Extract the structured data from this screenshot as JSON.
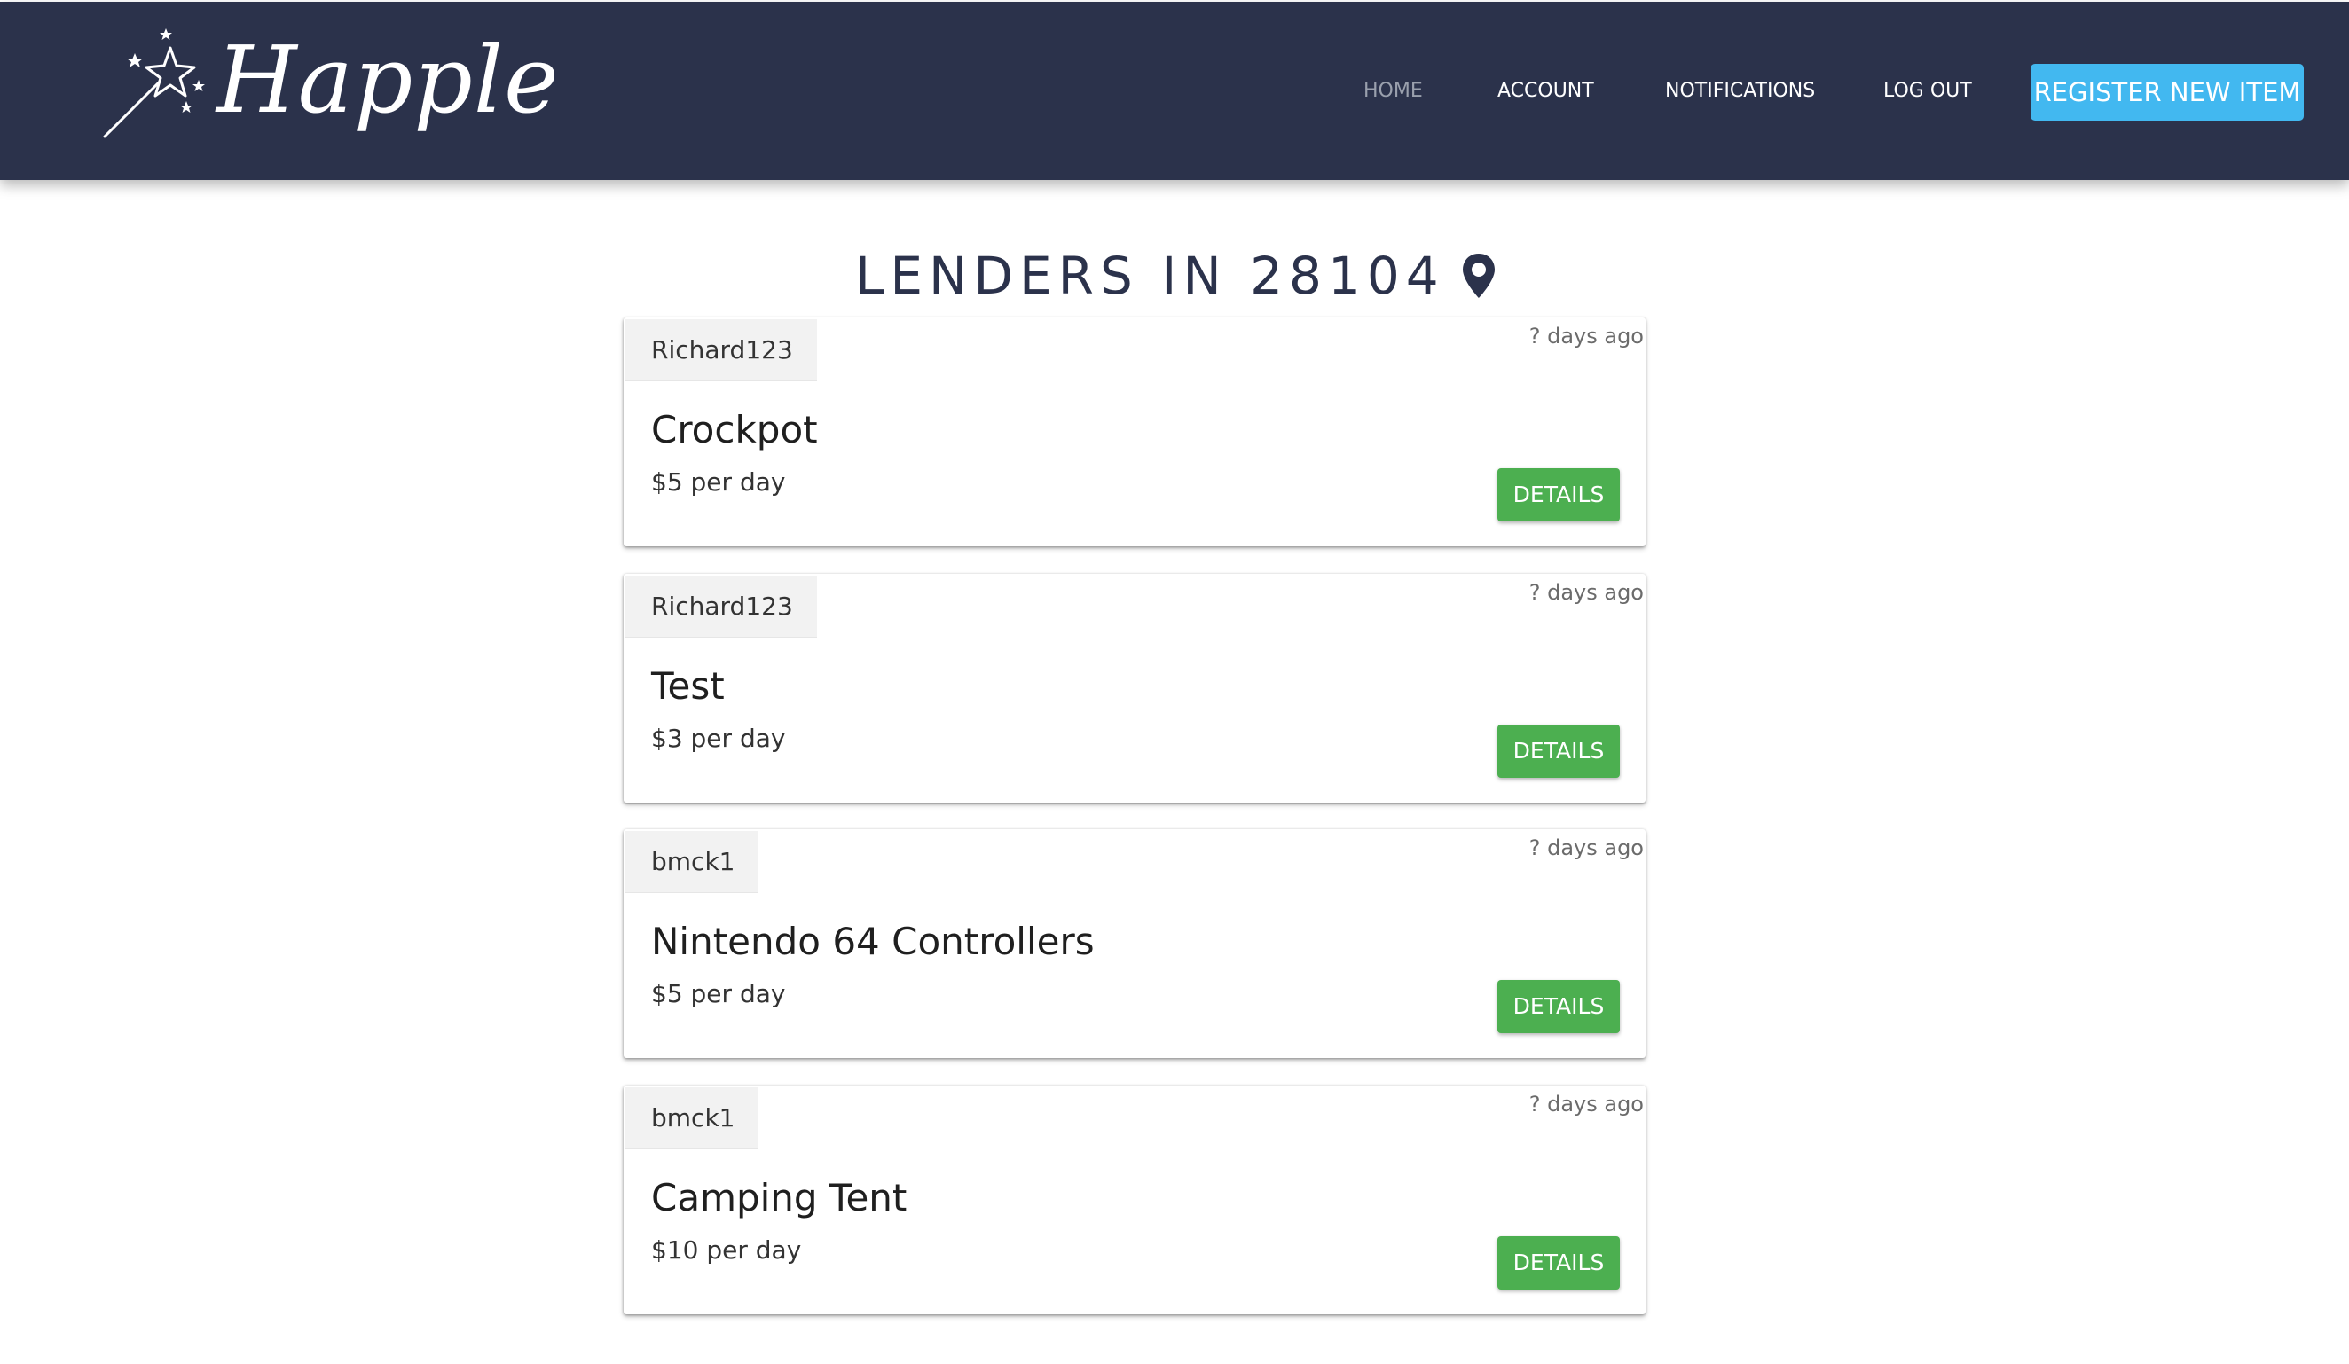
{
  "header": {
    "logo_text": "Happle",
    "nav": {
      "home": "HOME",
      "account": "ACCOUNT",
      "notifications": "NOTIFICATIONS",
      "logout": "LOG OUT"
    },
    "register_button": "REGISTER NEW ITEM"
  },
  "page": {
    "title": "LENDERS IN 28104"
  },
  "listings": [
    {
      "lender": "Richard123",
      "posted": "? days ago",
      "item": "Crockpot",
      "price": "$5 per day",
      "button": "DETAILS"
    },
    {
      "lender": "Richard123",
      "posted": "? days ago",
      "item": "Test",
      "price": "$3 per day",
      "button": "DETAILS"
    },
    {
      "lender": "bmck1",
      "posted": "? days ago",
      "item": "Nintendo 64 Controllers",
      "price": "$5 per day",
      "button": "DETAILS"
    },
    {
      "lender": "bmck1",
      "posted": "? days ago",
      "item": "Camping Tent",
      "price": "$10 per day",
      "button": "DETAILS"
    }
  ],
  "colors": {
    "navbar": "#2b324b",
    "register_button": "#42b8f0",
    "details_button": "#4caf50",
    "title": "#2b324b"
  },
  "icons": {
    "logo": "magic-wand-icon",
    "title_marker": "map-pin-icon"
  }
}
